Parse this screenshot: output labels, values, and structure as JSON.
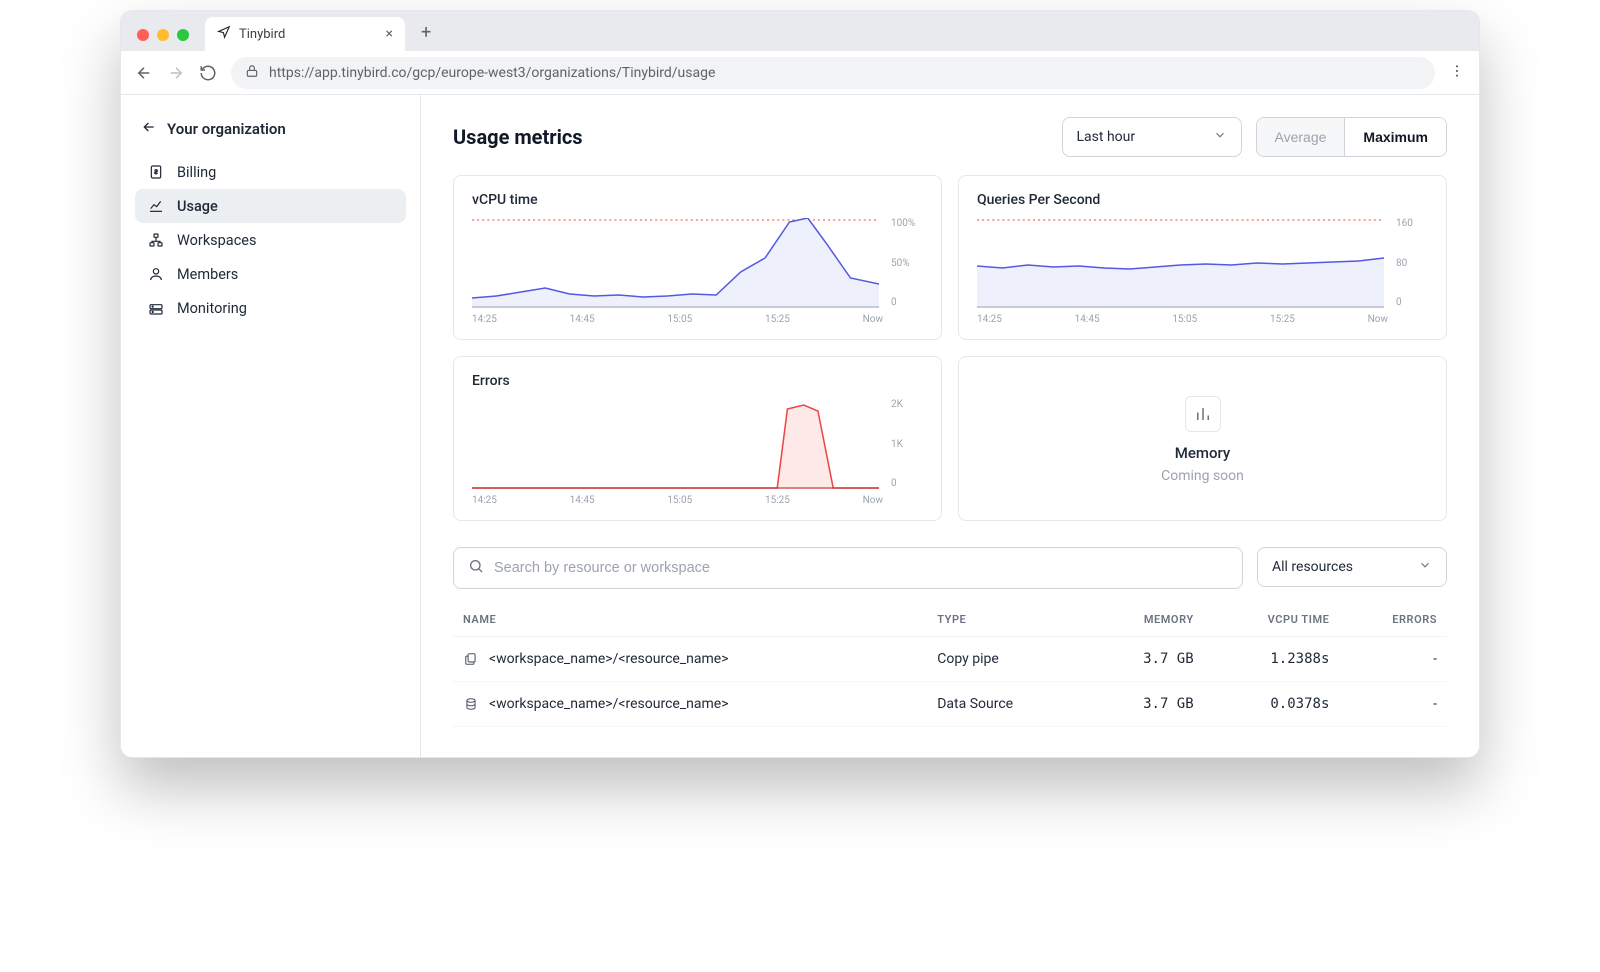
{
  "browser": {
    "tab_title": "Tinybird",
    "url": "https://app.tinybird.co/gcp/europe-west3/organizations/Tinybird/usage"
  },
  "sidebar": {
    "org_label": "Your organization",
    "items": [
      {
        "label": "Billing",
        "icon": "dollar-file-icon"
      },
      {
        "label": "Usage",
        "icon": "linechart-icon",
        "active": true
      },
      {
        "label": "Workspaces",
        "icon": "org-tree-icon"
      },
      {
        "label": "Members",
        "icon": "person-icon"
      },
      {
        "label": "Monitoring",
        "icon": "monitor-icon"
      }
    ]
  },
  "header": {
    "title": "Usage metrics",
    "time_range": "Last hour",
    "agg_options": [
      "Average",
      "Maximum"
    ],
    "agg_selected": "Maximum"
  },
  "cards": {
    "vcpu": {
      "title": "vCPU time",
      "ylabels": [
        "100%",
        "50%",
        "0"
      ],
      "xlabels": [
        "14:25",
        "14:45",
        "15:05",
        "15:25",
        "Now"
      ]
    },
    "qps": {
      "title": "Queries Per Second",
      "ylabels": [
        "160",
        "80",
        "0"
      ],
      "xlabels": [
        "14:25",
        "14:45",
        "15:05",
        "15:25",
        "Now"
      ]
    },
    "errors": {
      "title": "Errors",
      "ylabels": [
        "2K",
        "1K",
        "0"
      ],
      "xlabels": [
        "14:25",
        "14:45",
        "15:05",
        "15:25",
        "Now"
      ]
    },
    "memory": {
      "title": "Memory",
      "subtitle": "Coming soon"
    }
  },
  "resources": {
    "search_placeholder": "Search by resource or workspace",
    "filter": "All resources",
    "columns": [
      "NAME",
      "TYPE",
      "MEMORY",
      "VCPU TIME",
      "ERRORS"
    ],
    "rows": [
      {
        "icon": "pipe-icon",
        "name": "<workspace_name>/<resource_name>",
        "type": "Copy pipe",
        "memory": "3.7 GB",
        "vcpu": "1.2388s",
        "errors": "-"
      },
      {
        "icon": "datasource-icon",
        "name": "<workspace_name>/<resource_name>",
        "type": "Data Source",
        "memory": "3.7 GB",
        "vcpu": "0.0378s",
        "errors": "-"
      }
    ]
  },
  "chart_data": [
    {
      "type": "area",
      "title": "vCPU time",
      "x": [
        "14:25",
        "14:30",
        "14:35",
        "14:40",
        "14:45",
        "14:50",
        "14:55",
        "15:00",
        "15:05",
        "15:10",
        "15:15",
        "15:20",
        "15:25",
        "15:30",
        "15:35",
        "15:40",
        "Now"
      ],
      "values_pct": [
        12,
        14,
        18,
        22,
        16,
        14,
        15,
        13,
        14,
        16,
        15,
        40,
        55,
        95,
        100,
        70,
        30
      ],
      "ylim": [
        0,
        100
      ],
      "limit_pct": 100,
      "ylabel": "%",
      "color": "#5458e3"
    },
    {
      "type": "area",
      "title": "Queries Per Second",
      "x": [
        "14:25",
        "14:30",
        "14:35",
        "14:40",
        "14:45",
        "14:50",
        "14:55",
        "15:00",
        "15:05",
        "15:10",
        "15:15",
        "15:20",
        "15:25",
        "15:30",
        "15:35",
        "15:40",
        "Now"
      ],
      "values": [
        75,
        72,
        78,
        74,
        76,
        72,
        70,
        74,
        78,
        80,
        78,
        82,
        80,
        82,
        84,
        86,
        90
      ],
      "ylim": [
        0,
        160
      ],
      "limit": 160,
      "ylabel": "qps",
      "color": "#5458e3"
    },
    {
      "type": "area",
      "title": "Errors",
      "x": [
        "14:25",
        "14:30",
        "14:35",
        "14:40",
        "14:45",
        "14:50",
        "14:55",
        "15:00",
        "15:05",
        "15:10",
        "15:15",
        "15:20",
        "15:25",
        "15:30",
        "15:35",
        "15:40",
        "Now"
      ],
      "values": [
        0,
        0,
        0,
        0,
        0,
        0,
        0,
        0,
        0,
        0,
        0,
        0,
        1800,
        1900,
        1700,
        0,
        0
      ],
      "ylim": [
        0,
        2000
      ],
      "ylabel": "errors",
      "color": "#ef4444"
    }
  ]
}
